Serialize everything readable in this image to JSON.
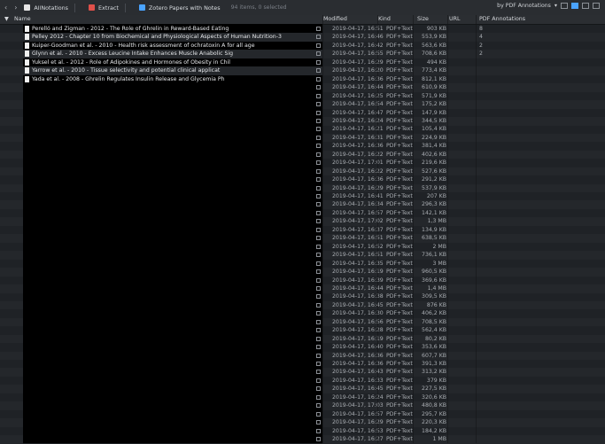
{
  "toolbar": {
    "back_icon": "chevron-left-icon",
    "forward_icon": "chevron-right-icon",
    "crumbs": [
      {
        "label": "AllNotations",
        "color": "#e7e7e7"
      },
      {
        "label": "Extract",
        "color": "#e0504a"
      },
      {
        "label": "Zotero Papers with Notes",
        "color": "#4aa3ff"
      }
    ],
    "status": "94 items, 0 selected",
    "sort_label": "by PDF Annotations",
    "accent": "#4aa3ff"
  },
  "columns": {
    "name": "Name",
    "modified": "Modified",
    "kind": "Kind",
    "size": "Size",
    "url": "URL",
    "annotations": "PDF Annotations"
  },
  "rows": [
    {
      "name": "Perelló and Zigman - 2012 - The Role of Ghrelin in Reward-Based Eating",
      "modified": "2019-04-17, 16:51",
      "kind": "PDF+Text",
      "size": "903 KB",
      "ann": "8"
    },
    {
      "name": "Pelley 2012 - Chapter 10 from Biochemical and Physiological Aspects of Human Nutrition-3",
      "modified": "2019-04-17, 16:46",
      "kind": "PDF+Text",
      "size": "553,9 KB",
      "ann": "4"
    },
    {
      "name": "Kuiper-Goodman et al. - 2010 - Health risk assessment of ochratoxin A for all age",
      "modified": "2019-04-17, 16:42",
      "kind": "PDF+Text",
      "size": "563,6 KB",
      "ann": "2"
    },
    {
      "name": "Glynn et al. - 2010 - Excess Leucine Intake Enhances Muscle Anabolic Sig",
      "modified": "2019-04-17, 16:55",
      "kind": "PDF+Text",
      "size": "708,6 KB",
      "ann": "2"
    },
    {
      "name": "Yuksel et al. - 2012 - Role of Adipokines and Hormones of Obesity in Chil",
      "modified": "2019-04-17, 16:29",
      "kind": "PDF+Text",
      "size": "494 KB",
      "ann": ""
    },
    {
      "name": "Yarrow et al. - 2010 - Tissue selectivity and potential clinical applicat",
      "modified": "2019-04-17, 16:20",
      "kind": "PDF+Text",
      "size": "773,4 KB",
      "ann": ""
    },
    {
      "name": "Yada et al. - 2008 - Ghrelin Regulates Insulin Release and Glycemia Ph",
      "modified": "2019-04-17, 16:36",
      "kind": "PDF+Text",
      "size": "812,1 KB",
      "ann": ""
    },
    {
      "name": "",
      "modified": "2019-04-17, 16:44",
      "kind": "PDF+Text",
      "size": "610,9 KB",
      "ann": ""
    },
    {
      "name": "",
      "modified": "2019-04-17, 16:25",
      "kind": "PDF+Text",
      "size": "571,9 KB",
      "ann": ""
    },
    {
      "name": "",
      "modified": "2019-04-17, 16:54",
      "kind": "PDF+Text",
      "size": "175,2 KB",
      "ann": ""
    },
    {
      "name": "",
      "modified": "2019-04-17, 16:47",
      "kind": "PDF+Text",
      "size": "147,9 KB",
      "ann": ""
    },
    {
      "name": "",
      "modified": "2019-04-17, 16:24",
      "kind": "PDF+Text",
      "size": "344,5 KB",
      "ann": ""
    },
    {
      "name": "",
      "modified": "2019-04-17, 16:21",
      "kind": "PDF+Text",
      "size": "105,4 KB",
      "ann": ""
    },
    {
      "name": "",
      "modified": "2019-04-17, 16:31",
      "kind": "PDF+Text",
      "size": "224,9 KB",
      "ann": ""
    },
    {
      "name": "",
      "modified": "2019-04-17, 16:36",
      "kind": "PDF+Text",
      "size": "381,4 KB",
      "ann": ""
    },
    {
      "name": "",
      "modified": "2019-04-17, 16:22",
      "kind": "PDF+Text",
      "size": "402,6 KB",
      "ann": ""
    },
    {
      "name": "",
      "modified": "2019-04-17, 17:01",
      "kind": "PDF+Text",
      "size": "219,6 KB",
      "ann": ""
    },
    {
      "name": "",
      "modified": "2019-04-17, 16:22",
      "kind": "PDF+Text",
      "size": "527,6 KB",
      "ann": ""
    },
    {
      "name": "",
      "modified": "2019-04-17, 16:36",
      "kind": "PDF+Text",
      "size": "291,2 KB",
      "ann": ""
    },
    {
      "name": "",
      "modified": "2019-04-17, 16:29",
      "kind": "PDF+Text",
      "size": "537,9 KB",
      "ann": ""
    },
    {
      "name": "",
      "modified": "2019-04-17, 16:41",
      "kind": "PDF+Text",
      "size": "207 KB",
      "ann": ""
    },
    {
      "name": "",
      "modified": "2019-04-17, 16:34",
      "kind": "PDF+Text",
      "size": "296,3 KB",
      "ann": ""
    },
    {
      "name": "",
      "modified": "2019-04-17, 16:57",
      "kind": "PDF+Text",
      "size": "142,1 KB",
      "ann": ""
    },
    {
      "name": "",
      "modified": "2019-04-17, 17:02",
      "kind": "PDF+Text",
      "size": "1,3 MB",
      "ann": ""
    },
    {
      "name": "",
      "modified": "2019-04-17, 16:37",
      "kind": "PDF+Text",
      "size": "134,9 KB",
      "ann": ""
    },
    {
      "name": "",
      "modified": "2019-04-17, 16:51",
      "kind": "PDF+Text",
      "size": "638,5 KB",
      "ann": ""
    },
    {
      "name": "",
      "modified": "2019-04-17, 16:52",
      "kind": "PDF+Text",
      "size": "2 MB",
      "ann": ""
    },
    {
      "name": "",
      "modified": "2019-04-17, 16:51",
      "kind": "PDF+Text",
      "size": "736,1 KB",
      "ann": ""
    },
    {
      "name": "",
      "modified": "2019-04-17, 16:35",
      "kind": "PDF+Text",
      "size": "3 MB",
      "ann": ""
    },
    {
      "name": "",
      "modified": "2019-04-17, 16:19",
      "kind": "PDF+Text",
      "size": "960,5 KB",
      "ann": ""
    },
    {
      "name": "",
      "modified": "2019-04-17, 16:39",
      "kind": "PDF+Text",
      "size": "369,6 KB",
      "ann": ""
    },
    {
      "name": "",
      "modified": "2019-04-17, 16:44",
      "kind": "PDF+Text",
      "size": "1,4 MB",
      "ann": ""
    },
    {
      "name": "",
      "modified": "2019-04-17, 16:38",
      "kind": "PDF+Text",
      "size": "309,5 KB",
      "ann": ""
    },
    {
      "name": "",
      "modified": "2019-04-17, 16:45",
      "kind": "PDF+Text",
      "size": "876 KB",
      "ann": ""
    },
    {
      "name": "",
      "modified": "2019-04-17, 16:30",
      "kind": "PDF+Text",
      "size": "406,2 KB",
      "ann": ""
    },
    {
      "name": "",
      "modified": "2019-04-17, 16:56",
      "kind": "PDF+Text",
      "size": "708,5 KB",
      "ann": ""
    },
    {
      "name": "",
      "modified": "2019-04-17, 16:28",
      "kind": "PDF+Text",
      "size": "562,4 KB",
      "ann": ""
    },
    {
      "name": "",
      "modified": "2019-04-17, 16:19",
      "kind": "PDF+Text",
      "size": "80,2 KB",
      "ann": ""
    },
    {
      "name": "",
      "modified": "2019-04-17, 16:40",
      "kind": "PDF+Text",
      "size": "353,6 KB",
      "ann": ""
    },
    {
      "name": "",
      "modified": "2019-04-17, 16:36",
      "kind": "PDF+Text",
      "size": "607,7 KB",
      "ann": ""
    },
    {
      "name": "",
      "modified": "2019-04-17, 16:36",
      "kind": "PDF+Text",
      "size": "391,3 KB",
      "ann": ""
    },
    {
      "name": "",
      "modified": "2019-04-17, 16:43",
      "kind": "PDF+Text",
      "size": "313,2 KB",
      "ann": ""
    },
    {
      "name": "",
      "modified": "2019-04-17, 16:33",
      "kind": "PDF+Text",
      "size": "379 KB",
      "ann": ""
    },
    {
      "name": "",
      "modified": "2019-04-17, 16:45",
      "kind": "PDF+Text",
      "size": "227,5 KB",
      "ann": ""
    },
    {
      "name": "",
      "modified": "2019-04-17, 16:24",
      "kind": "PDF+Text",
      "size": "320,6 KB",
      "ann": ""
    },
    {
      "name": "",
      "modified": "2019-04-17, 17:03",
      "kind": "PDF+Text",
      "size": "480,8 KB",
      "ann": ""
    },
    {
      "name": "",
      "modified": "2019-04-17, 16:57",
      "kind": "PDF+Text",
      "size": "295,7 KB",
      "ann": ""
    },
    {
      "name": "",
      "modified": "2019-04-17, 16:29",
      "kind": "PDF+Text",
      "size": "220,3 KB",
      "ann": ""
    },
    {
      "name": "",
      "modified": "2019-04-17, 16:53",
      "kind": "PDF+Text",
      "size": "184,2 KB",
      "ann": ""
    },
    {
      "name": "",
      "modified": "2019-04-17, 16:27",
      "kind": "PDF+Text",
      "size": "1 MB",
      "ann": ""
    }
  ]
}
